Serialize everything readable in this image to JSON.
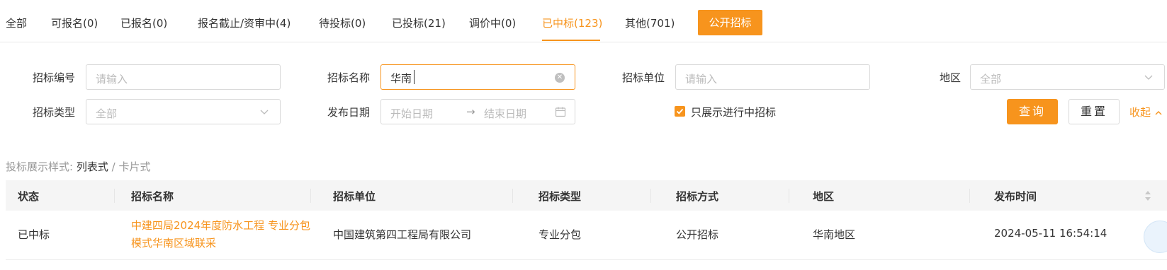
{
  "tabs": [
    {
      "label": "全部"
    },
    {
      "label": "可报名(0)"
    },
    {
      "label": "已报名(0)"
    },
    {
      "label": "报名截止/资审中(4)"
    },
    {
      "label": "待投标(0)"
    },
    {
      "label": "已投标(21)"
    },
    {
      "label": "调价中(0)"
    },
    {
      "label": "已中标(123)",
      "active": true
    },
    {
      "label": "其他(701)"
    }
  ],
  "public_tender_button": "公开招标",
  "filters": {
    "tender_no": {
      "label": "招标编号",
      "placeholder": "请输入"
    },
    "tender_name": {
      "label": "招标名称",
      "value": "华南"
    },
    "tender_unit": {
      "label": "招标单位",
      "placeholder": "请输入"
    },
    "region": {
      "label": "地区",
      "placeholder": "全部"
    },
    "tender_type": {
      "label": "招标类型",
      "placeholder": "全部"
    },
    "publish_date": {
      "label": "发布日期",
      "start_placeholder": "开始日期",
      "end_placeholder": "结束日期",
      "separator": "→"
    },
    "only_ongoing": {
      "label": "只展示进行中招标",
      "checked": true
    }
  },
  "actions": {
    "query": "查询",
    "reset": "重置",
    "collapse": "收起"
  },
  "view_style": {
    "prefix": "投标展示样式:",
    "list": "列表式",
    "separator": "/",
    "card": "卡片式"
  },
  "table": {
    "columns": [
      "状态",
      "招标名称",
      "招标单位",
      "招标类型",
      "招标方式",
      "地区",
      "发布时间"
    ],
    "rows": [
      {
        "status": "已中标",
        "name": "中建四局2024年度防水工程 专业分包模式华南区域联采",
        "unit": "中国建筑第四工程局有限公司",
        "type": "专业分包",
        "method": "公开招标",
        "region": "华南地区",
        "publish_time": "2024-05-11 16:54:14"
      }
    ]
  },
  "colors": {
    "accent": "#f7941d"
  }
}
